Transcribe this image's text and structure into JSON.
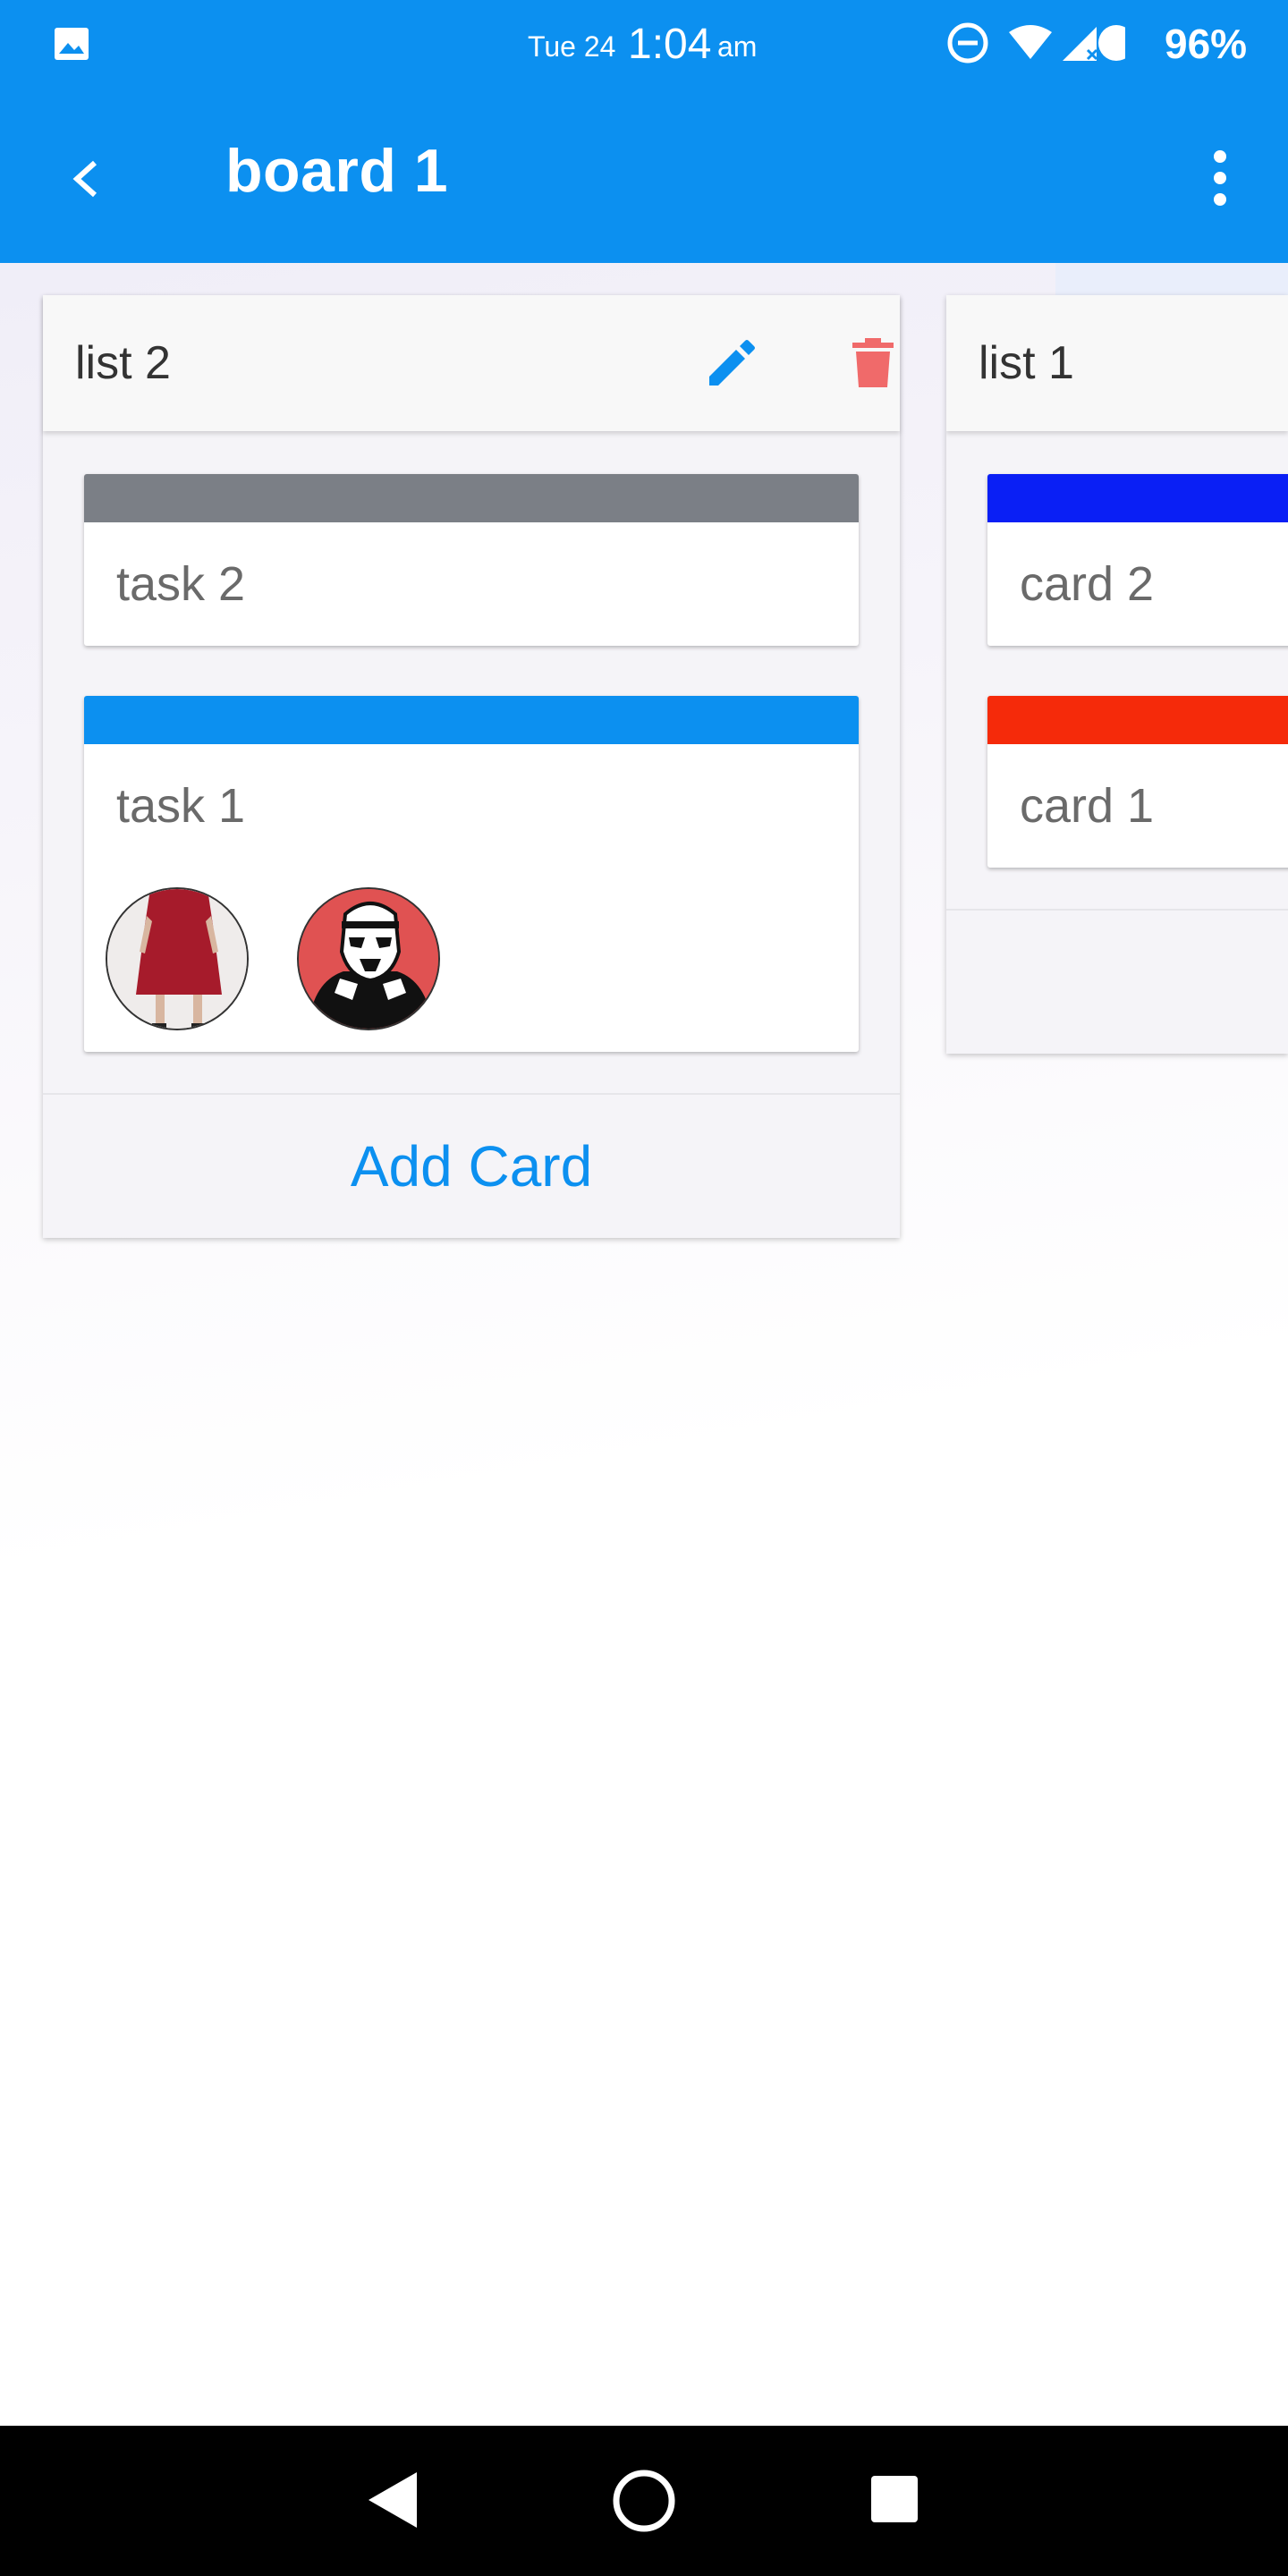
{
  "status_bar": {
    "date": "Tue 24",
    "time": "1:04",
    "ampm": "am",
    "battery": "96%",
    "icons": [
      "gallery-icon",
      "dnd-icon",
      "wifi-icon",
      "signal-icon",
      "battery-icon"
    ]
  },
  "app_bar": {
    "title": "board 1",
    "back_icon": "back-arrow-icon",
    "menu_icon": "more-vert-icon"
  },
  "lists": [
    {
      "title": "list 2",
      "edit_icon": "pencil-icon",
      "delete_icon": "trash-icon",
      "cards": [
        {
          "title": "task 2",
          "color": "#7b7f86"
        },
        {
          "title": "task 1",
          "color": "#0c90f0",
          "members": [
            "avatar-red-dress",
            "avatar-stormtrooper"
          ]
        }
      ],
      "add_card_label": "Add Card"
    },
    {
      "title": "list 1",
      "cards": [
        {
          "title": "card 2",
          "color": "#0a1ff5"
        },
        {
          "title": "card 1",
          "color": "#f52a0a"
        }
      ]
    }
  ],
  "colors": {
    "primary": "#0c90f0",
    "delete": "#f06a6a",
    "nav_bar": "#000000"
  }
}
